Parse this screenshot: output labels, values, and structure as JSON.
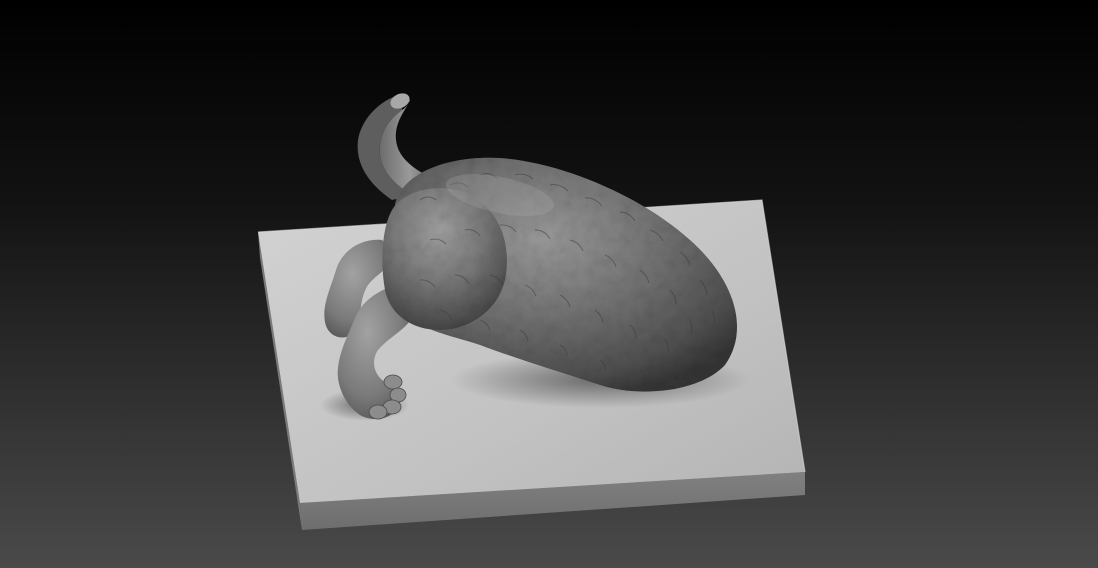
{
  "scene": {
    "subject": "sculpted-animal-model-on-base",
    "background_top_color": "#000000",
    "background_bottom_color": "#4a4a4a",
    "base_top_color": "#c2c2c2",
    "base_side_color": "#6e6e6e",
    "model_color": "#6a6a6a",
    "model_highlight_color": "#9a9a9a",
    "model_shadow_color": "#2e2e2e"
  }
}
